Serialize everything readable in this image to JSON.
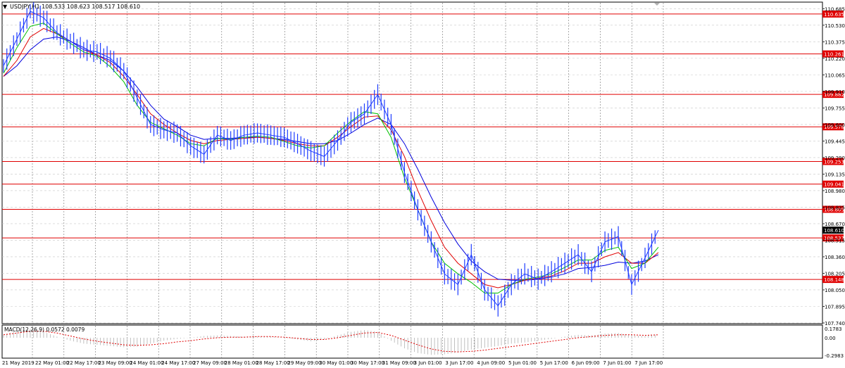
{
  "header": {
    "title": "USDJPY,H1  108.533 108.623 108.517 108.610",
    "menu_icon": "triangle-down-icon"
  },
  "macd": {
    "label": "MACD(12,26,9) 0.0572 0.0079",
    "scale_labels": [
      "0.1783",
      "0.00",
      "-0.2983"
    ]
  },
  "price_axis": {
    "labels": [
      "110.685",
      "110.530",
      "110.375",
      "110.220",
      "110.065",
      "109.910",
      "109.755",
      "109.600",
      "109.445",
      "109.290",
      "109.135",
      "108.980",
      "108.825",
      "108.670",
      "108.515",
      "108.360",
      "108.205",
      "108.050",
      "107.895",
      "107.740"
    ],
    "current_price": "108.610"
  },
  "levels": [
    "110.635",
    "110.261",
    "109.882",
    "109.578",
    "109.253",
    "109.041",
    "108.805",
    "108.537",
    "108.148"
  ],
  "time_axis": {
    "labels": [
      "21 May 2019",
      "22 May 01:00",
      "22 May 17:00",
      "23 May 09:00",
      "24 May 01:00",
      "24 May 17:00",
      "27 May 09:00",
      "28 May 01:00",
      "28 May 17:00",
      "29 May 09:00",
      "30 May 01:00",
      "30 May 17:00",
      "31 May 09:00",
      "3 Jun 01:00",
      "3 Jun 17:00",
      "4 Jun 09:00",
      "5 Jun 01:00",
      "5 Jun 17:00",
      "6 Jun 09:00",
      "7 Jun 01:00",
      "7 Jun 17:00"
    ]
  },
  "colors": {
    "price_line": "#1e3cff",
    "ma_fast": "#00c000",
    "ma_mid": "#e00000",
    "ma_slow": "#0000dd",
    "level_line": "#e00000",
    "level_label_bg": "#e00000",
    "current_label_bg": "#000000",
    "macd_hist": "#b0b0b0",
    "macd_signal": "#e00000",
    "grid": "#c8c8c8"
  },
  "chart_data": {
    "type": "line",
    "symbol": "USDJPY",
    "timeframe": "H1",
    "last_ohlc": {
      "open": 108.533,
      "high": 108.623,
      "low": 108.517,
      "close": 108.61
    },
    "ylim": [
      107.74,
      110.74
    ],
    "x_tick_labels": [
      "21 May 2019",
      "22 May 01:00",
      "22 May 17:00",
      "23 May 09:00",
      "24 May 01:00",
      "24 May 17:00",
      "27 May 09:00",
      "28 May 01:00",
      "28 May 17:00",
      "29 May 09:00",
      "30 May 01:00",
      "30 May 17:00",
      "31 May 09:00",
      "3 Jun 01:00",
      "3 Jun 17:00",
      "4 Jun 09:00",
      "5 Jun 01:00",
      "5 Jun 17:00",
      "6 Jun 09:00",
      "7 Jun 01:00",
      "7 Jun 17:00"
    ],
    "price_close": [
      110.15,
      110.4,
      110.66,
      110.6,
      110.46,
      110.38,
      110.3,
      110.28,
      110.22,
      110.1,
      109.85,
      109.6,
      109.55,
      109.52,
      109.4,
      109.32,
      109.5,
      109.45,
      109.5,
      109.52,
      109.5,
      109.48,
      109.42,
      109.35,
      109.3,
      109.45,
      109.62,
      109.7,
      109.88,
      109.6,
      109.15,
      108.8,
      108.5,
      108.2,
      108.1,
      108.38,
      108.05,
      107.9,
      108.1,
      108.2,
      108.15,
      108.22,
      108.3,
      108.38,
      108.22,
      108.5,
      108.55,
      108.1,
      108.35,
      108.61
    ],
    "ma_fast": [
      110.08,
      110.32,
      110.52,
      110.55,
      110.45,
      110.36,
      110.28,
      110.24,
      110.14,
      110.0,
      109.78,
      109.62,
      109.56,
      109.5,
      109.42,
      109.4,
      109.47,
      109.46,
      109.48,
      109.49,
      109.48,
      109.44,
      109.4,
      109.38,
      109.4,
      109.52,
      109.63,
      109.72,
      109.7,
      109.48,
      109.1,
      108.8,
      108.5,
      108.3,
      108.2,
      108.12,
      108.02,
      108.02,
      108.1,
      108.15,
      108.17,
      108.2,
      108.26,
      108.33,
      108.33,
      108.42,
      108.45,
      108.25,
      108.3,
      108.45
    ],
    "ma_mid": [
      110.05,
      110.2,
      110.42,
      110.5,
      110.45,
      110.38,
      110.3,
      110.25,
      110.18,
      110.05,
      109.88,
      109.7,
      109.6,
      109.52,
      109.45,
      109.42,
      109.45,
      109.46,
      109.47,
      109.48,
      109.47,
      109.45,
      109.42,
      109.4,
      109.4,
      109.48,
      109.58,
      109.67,
      109.68,
      109.55,
      109.3,
      108.98,
      108.7,
      108.45,
      108.3,
      108.2,
      108.1,
      108.07,
      108.1,
      108.14,
      108.16,
      108.18,
      108.23,
      108.3,
      108.3,
      108.36,
      108.4,
      108.3,
      108.3,
      108.4
    ],
    "ma_slow": [
      110.05,
      110.15,
      110.3,
      110.4,
      110.42,
      110.38,
      110.32,
      110.25,
      110.2,
      110.1,
      109.95,
      109.78,
      109.65,
      109.58,
      109.5,
      109.46,
      109.47,
      109.47,
      109.48,
      109.48,
      109.47,
      109.46,
      109.44,
      109.42,
      109.42,
      109.45,
      109.52,
      109.6,
      109.66,
      109.6,
      109.42,
      109.18,
      108.92,
      108.68,
      108.48,
      108.32,
      108.22,
      108.15,
      108.14,
      108.14,
      108.15,
      108.17,
      108.2,
      108.25,
      108.26,
      108.28,
      108.31,
      108.3,
      108.32,
      108.38
    ],
    "macd_series": {
      "name": "MACD(12,26,9)",
      "values": [
        0.05,
        0.12,
        0.15,
        0.1,
        0.02,
        -0.05,
        -0.1,
        -0.12,
        -0.14,
        -0.16,
        -0.15,
        -0.1,
        -0.05,
        -0.02,
        0.0,
        0.03,
        0.04,
        0.03,
        0.02,
        0.02,
        0.02,
        0.0,
        -0.03,
        -0.06,
        -0.03,
        0.04,
        0.1,
        0.13,
        0.1,
        -0.05,
        -0.18,
        -0.26,
        -0.29,
        -0.28,
        -0.25,
        -0.2,
        -0.17,
        -0.14,
        -0.1,
        -0.08,
        -0.05,
        -0.02,
        0.02,
        0.05,
        0.04,
        0.07,
        0.08,
        0.04,
        0.03,
        0.06
      ],
      "signal": [
        0.05,
        0.08,
        0.11,
        0.11,
        0.08,
        0.03,
        -0.02,
        -0.06,
        -0.09,
        -0.12,
        -0.13,
        -0.12,
        -0.1,
        -0.07,
        -0.05,
        -0.02,
        0.0,
        0.01,
        0.01,
        0.02,
        0.02,
        0.01,
        -0.01,
        -0.03,
        -0.03,
        0.0,
        0.04,
        0.08,
        0.09,
        0.04,
        -0.04,
        -0.12,
        -0.19,
        -0.23,
        -0.24,
        -0.23,
        -0.21,
        -0.18,
        -0.15,
        -0.12,
        -0.09,
        -0.06,
        -0.03,
        0.0,
        0.02,
        0.04,
        0.05,
        0.05,
        0.04,
        0.05
      ]
    },
    "grid": true
  }
}
